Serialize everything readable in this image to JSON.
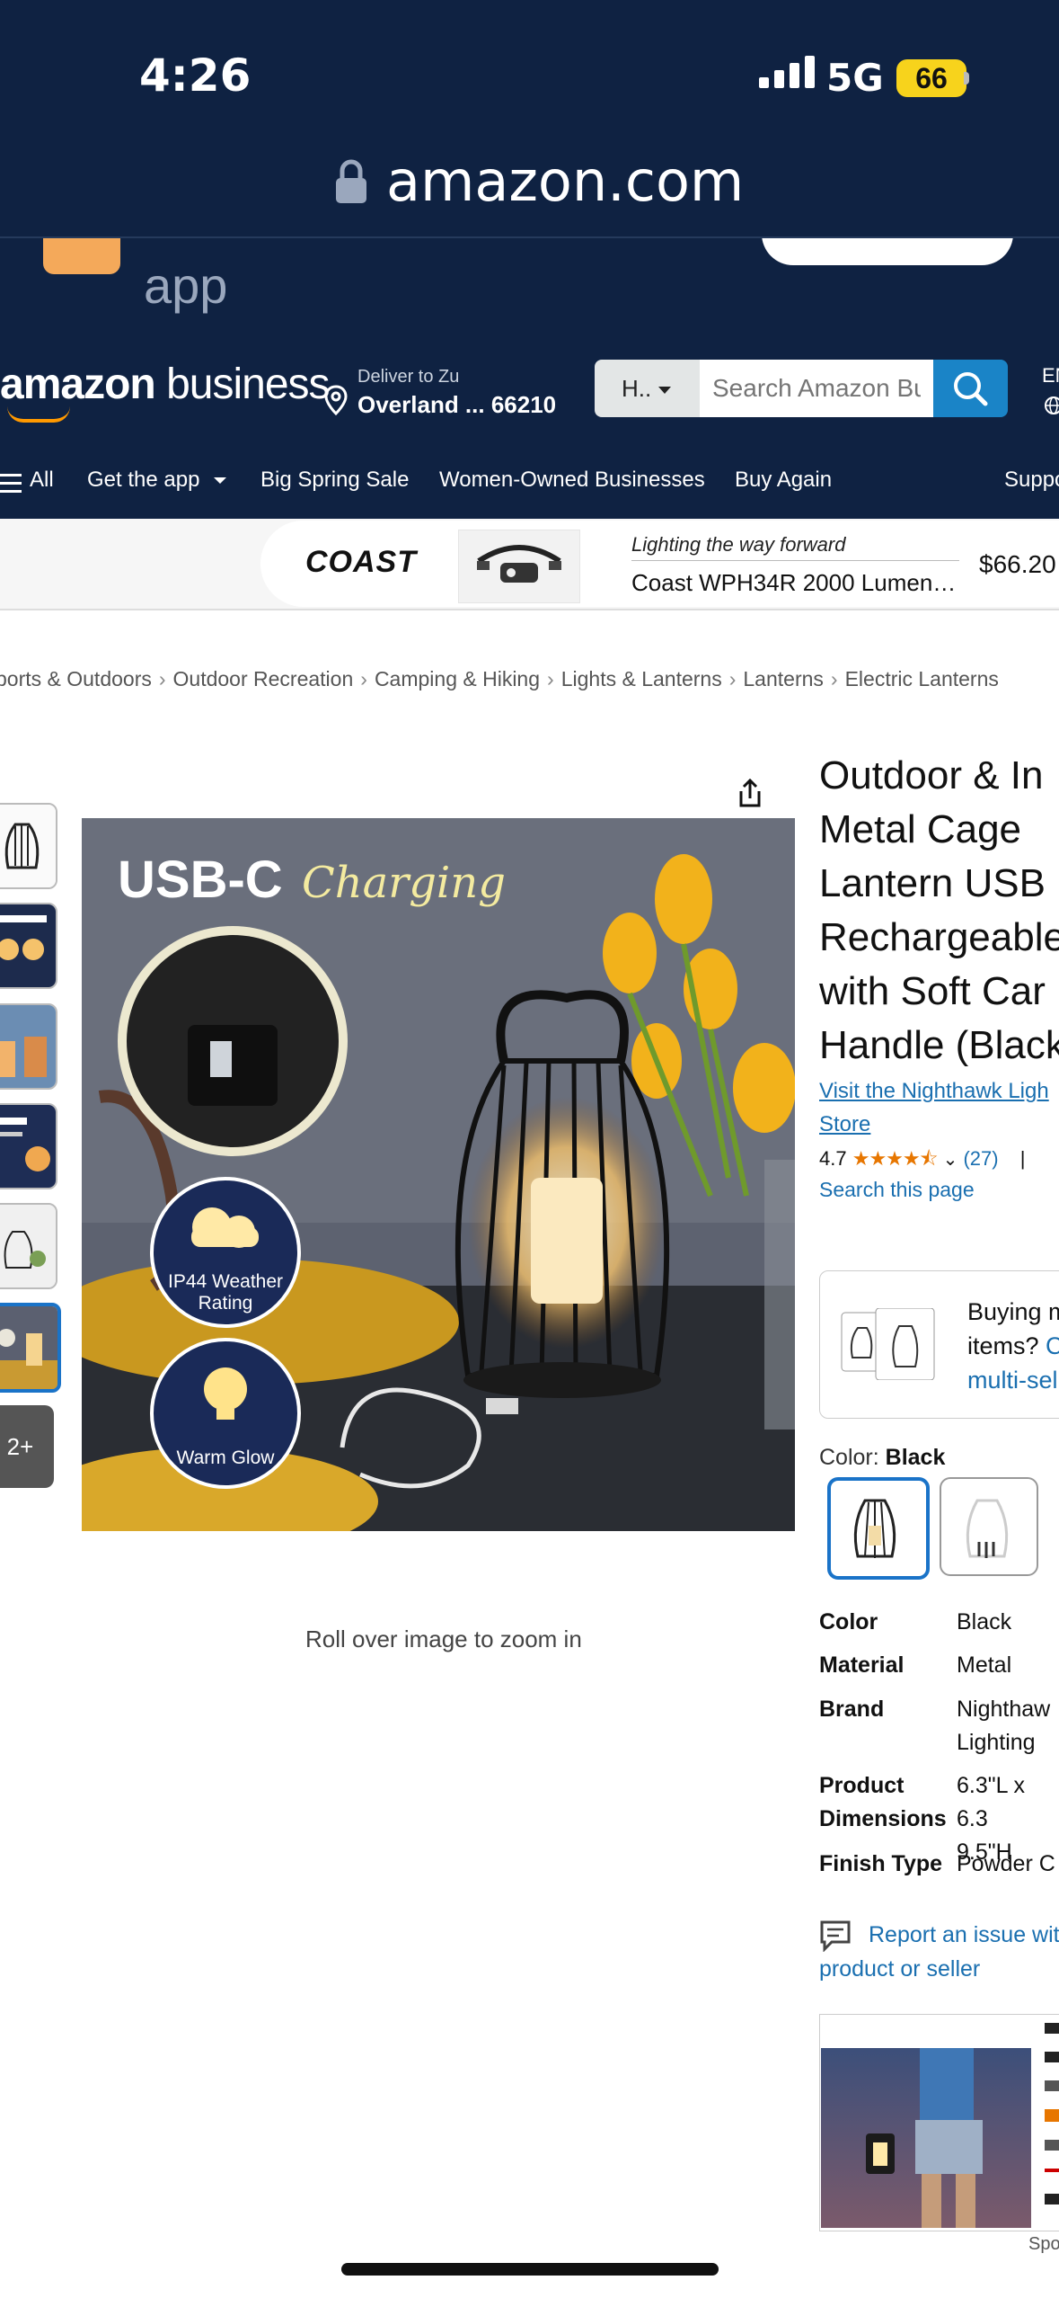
{
  "status_bar": {
    "time": "4:26",
    "network": "5G",
    "battery": "66"
  },
  "browser": {
    "url": "amazon.com"
  },
  "app_banner": {
    "text": "app"
  },
  "header": {
    "logo_prefix": "amazon",
    "logo_suffix": "business",
    "deliver_label": "Deliver to Zu",
    "deliver_location": "Overland ... 66210",
    "search_category": "H..",
    "search_placeholder": "Search Amazon Bu",
    "language": "EN"
  },
  "nav": {
    "items": [
      "All",
      "Get the app",
      "Big Spring Sale",
      "Women-Owned Businesses",
      "Buy Again",
      "Suppo"
    ]
  },
  "ad": {
    "brand": "COAST",
    "tagline": "Lighting the way forward",
    "product": "Coast WPH34R 2000 Lumen…",
    "price": "$66.20"
  },
  "breadcrumb": [
    "ports & Outdoors",
    "Outdoor Recreation",
    "Camping & Hiking",
    "Lights & Lanterns",
    "Lanterns",
    "Electric Lanterns"
  ],
  "gallery": {
    "more_label": "2+",
    "image_headline": "USB-C",
    "image_headline_script": "Charging",
    "badge_weather": "IP44 Weather Rating",
    "badge_glow": "Warm Glow",
    "zoom_hint": "Roll over image to zoom in"
  },
  "product": {
    "title_lines": [
      "Outdoor & In",
      "Metal Cage",
      "Lantern USB",
      "Rechargeable",
      "with Soft Car",
      "Handle (Black"
    ],
    "store_link_line1": "Visit the Nighthawk Ligh",
    "store_link_line2": "Store",
    "rating_value": "4.7",
    "rating_stars": 4.7,
    "rating_count": "(27)",
    "rating_sep": "|",
    "search_page": "Search this page",
    "multi_line1": "Buying m",
    "multi_line2": "items?",
    "multi_line2_link": "C",
    "multi_line3": "multi-sel",
    "color_label": "Color:",
    "color_value": "Black",
    "specs": [
      {
        "key": "Color",
        "value": "Black"
      },
      {
        "key": "Material",
        "value": "Metal"
      },
      {
        "key": "Brand",
        "value": "Nighthaw\nLighting"
      },
      {
        "key": "Product\nDimensions",
        "value": "6.3\"L x 6.3\n9.5\"H"
      },
      {
        "key": "Finish Type",
        "value": "Powder C"
      }
    ],
    "report_line1": "Report an issue with",
    "report_line2": "product or seller",
    "sponsored_label": "Spo"
  },
  "colors": {
    "navy": "#0f2242",
    "link": "#1a6fb0",
    "star": "#e77600",
    "search_button": "#1a84c7"
  }
}
